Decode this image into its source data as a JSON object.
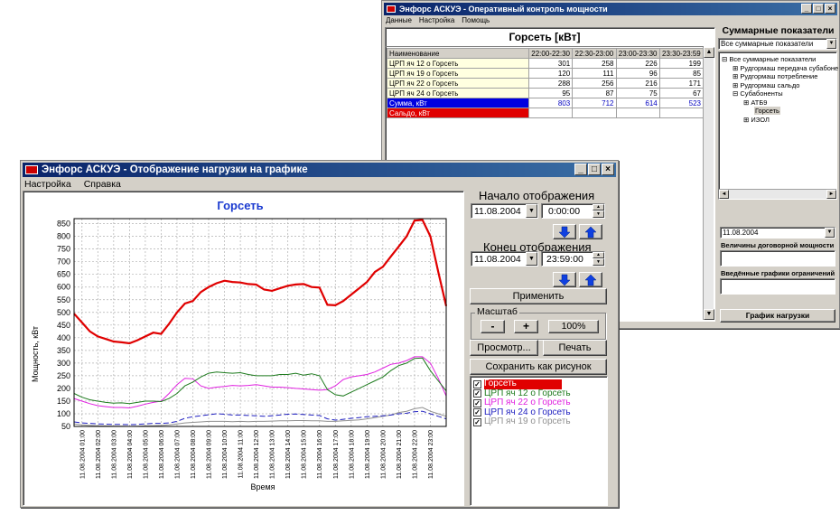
{
  "back_window": {
    "title": "Энфорс АСКУЭ - Оперативный контроль мощности",
    "menu": [
      "Данные",
      "Настройка",
      "Помощь"
    ],
    "table_title": "Горсеть [кВт]",
    "columns": [
      "Наименование",
      "22:00-22:30",
      "22:30-23:00",
      "23:00-23:30",
      "23:30-23:59"
    ],
    "rows": [
      {
        "name": "ЦРП яч 12 о Горсеть",
        "values": [
          "301",
          "258",
          "226",
          "199"
        ],
        "style": "normal"
      },
      {
        "name": "ЦРП яч 19 о Горсеть",
        "values": [
          "120",
          "111",
          "96",
          "85"
        ],
        "style": "normal"
      },
      {
        "name": "ЦРП яч 22 о Горсеть",
        "values": [
          "288",
          "256",
          "216",
          "171"
        ],
        "style": "normal"
      },
      {
        "name": "ЦРП яч 24 о Горсеть",
        "values": [
          "95",
          "87",
          "75",
          "67"
        ],
        "style": "normal"
      },
      {
        "name": "Сумма, кВт",
        "values": [
          "803",
          "712",
          "614",
          "523"
        ],
        "style": "sum"
      },
      {
        "name": "Сальдо, кВт",
        "values": [
          "",
          "",
          "",
          ""
        ],
        "style": "saldo"
      }
    ],
    "side_title": "Суммарные показатели",
    "side_select": "Все суммарные показатели",
    "tree": [
      {
        "sym": "⊟",
        "label": "Все суммарные показатели",
        "level": 0
      },
      {
        "sym": "⊞",
        "label": "Рудгормаш передача субабоне",
        "level": 1
      },
      {
        "sym": "⊞",
        "label": "Рудгормаш потребление",
        "level": 1
      },
      {
        "sym": "⊞",
        "label": "Рудгормаш сальдо",
        "level": 1
      },
      {
        "sym": "⊟",
        "label": "Субабоненты",
        "level": 1
      },
      {
        "sym": "⊞",
        "label": "АТБ9",
        "level": 2
      },
      {
        "sym": "",
        "label": "Горсеть",
        "level": 2
      },
      {
        "sym": "⊞",
        "label": "ИЗОЛ",
        "level": 2
      }
    ],
    "date_value": "11.08.2004",
    "contract_label": "Величины договорной мощности",
    "limits_label": "Введённые графики ограничений",
    "graph_button": "График нагрузки"
  },
  "front_window": {
    "title": "Энфорс АСКУЭ - Отображение нагрузки на графике",
    "menu": [
      "Настройка",
      "Справка"
    ],
    "start_label": "Начало отображения",
    "start_date": "11.08.2004",
    "start_time": "0:00:00",
    "end_label": "Конец отображения",
    "end_date": "11.08.2004",
    "end_time": "23:59:00",
    "apply_button": "Применить",
    "scale_label": "Масштаб",
    "scale_minus": "-",
    "scale_plus": "+",
    "scale_value": "100%",
    "preview_button": "Просмотр...",
    "print_button": "Печать",
    "save_button": "Сохранить как рисунок",
    "legend": [
      {
        "label": "Горсеть",
        "color": "#ffffff",
        "bg": "#e00000"
      },
      {
        "label": "ЦРП яч 12 о Горсеть",
        "color": "#1e7b1e",
        "bg": ""
      },
      {
        "label": "ЦРП яч 22 о Горсеть",
        "color": "#e020e0",
        "bg": ""
      },
      {
        "label": "ЦРП яч 24 о Горсеть",
        "color": "#2020c0",
        "bg": ""
      },
      {
        "label": "ЦРП яч 19 о Горсеть",
        "color": "#909090",
        "bg": ""
      }
    ]
  },
  "chart_data": {
    "type": "line",
    "title": "Горсеть",
    "xlabel": "Время",
    "ylabel": "Мощность, кВт",
    "ylim": [
      50,
      870
    ],
    "yticks": [
      50,
      100,
      150,
      200,
      250,
      300,
      350,
      400,
      450,
      500,
      550,
      600,
      650,
      700,
      750,
      800,
      850
    ],
    "xlim": [
      0.5,
      24.0
    ],
    "x_tick_labels": [
      "11.08.2004 01:00",
      "11.08.2004 02:00",
      "11.08.2004 03:00",
      "11.08.2004 04:00",
      "11.08.2004 05:00",
      "11.08.2004 06:00",
      "11.08.2004 07:00",
      "11.08.2004 08:00",
      "11.08.2004 09:00",
      "11.08.2004 10:00",
      "11.08.2004 11:00",
      "11.08.2004 12:00",
      "11.08.2004 13:00",
      "11.08.2004 14:00",
      "11.08.2004 15:00",
      "11.08.2004 16:00",
      "11.08.2004 17:00",
      "11.08.2004 18:00",
      "11.08.2004 19:00",
      "11.08.2004 20:00",
      "11.08.2004 21:00",
      "11.08.2004 22:00",
      "11.08.2004 23:00"
    ],
    "x_tick_hours": [
      1,
      2,
      3,
      4,
      5,
      6,
      7,
      8,
      9,
      10,
      11,
      12,
      13,
      14,
      15,
      16,
      17,
      18,
      19,
      20,
      21,
      22,
      23
    ],
    "grid": true,
    "series": [
      {
        "name": "Горсеть",
        "color": "#e00000",
        "width": 2.2,
        "dash": "",
        "x": [
          0.5,
          1,
          1.5,
          2,
          2.5,
          3,
          3.5,
          4,
          4.5,
          5,
          5.5,
          6,
          6.5,
          7,
          7.5,
          8,
          8.5,
          9,
          9.5,
          10,
          10.5,
          11,
          11.5,
          12,
          12.5,
          13,
          13.5,
          14,
          14.5,
          15,
          15.5,
          16,
          16.5,
          17,
          17.5,
          18,
          18.5,
          19,
          19.5,
          20,
          20.5,
          21,
          21.5,
          22,
          22.5,
          23,
          23.5,
          24
        ],
        "y": [
          495,
          460,
          425,
          405,
          395,
          385,
          382,
          378,
          390,
          405,
          420,
          415,
          455,
          500,
          535,
          545,
          580,
          600,
          615,
          625,
          620,
          618,
          612,
          610,
          590,
          585,
          595,
          605,
          610,
          612,
          600,
          598,
          530,
          528,
          545,
          570,
          595,
          620,
          660,
          680,
          720,
          760,
          800,
          862,
          865,
          800,
          660,
          525
        ]
      },
      {
        "name": "ЦРП яч 12 о Горсеть",
        "color": "#1e7b1e",
        "width": 1,
        "dash": "",
        "x": [
          0.5,
          1,
          1.5,
          2,
          2.5,
          3,
          3.5,
          4,
          4.5,
          5,
          5.5,
          6,
          6.5,
          7,
          7.5,
          8,
          8.5,
          9,
          9.5,
          10,
          10.5,
          11,
          11.5,
          12,
          12.5,
          13,
          13.5,
          14,
          14.5,
          15,
          15.5,
          16,
          16.5,
          17,
          17.5,
          18,
          18.5,
          19,
          19.5,
          20,
          20.5,
          21,
          21.5,
          22,
          22.5,
          23,
          23.5,
          24
        ],
        "y": [
          180,
          165,
          155,
          150,
          145,
          142,
          143,
          140,
          145,
          150,
          150,
          148,
          160,
          180,
          210,
          225,
          245,
          260,
          265,
          262,
          260,
          262,
          255,
          250,
          250,
          250,
          255,
          255,
          260,
          252,
          258,
          250,
          195,
          175,
          170,
          185,
          200,
          215,
          230,
          245,
          270,
          290,
          300,
          318,
          320,
          270,
          230,
          190
        ]
      },
      {
        "name": "ЦРП яч 22 о Горсеть",
        "color": "#e020e0",
        "width": 1,
        "dash": "",
        "x": [
          0.5,
          1,
          1.5,
          2,
          2.5,
          3,
          3.5,
          4,
          4.5,
          5,
          5.5,
          6,
          6.5,
          7,
          7.5,
          8,
          8.5,
          9,
          9.5,
          10,
          10.5,
          11,
          11.5,
          12,
          12.5,
          13,
          13.5,
          14,
          14.5,
          15,
          15.5,
          16,
          16.5,
          17,
          17.5,
          18,
          18.5,
          19,
          19.5,
          20,
          20.5,
          21,
          21.5,
          22,
          22.5,
          23,
          23.5,
          24
        ],
        "y": [
          160,
          150,
          140,
          132,
          128,
          125,
          125,
          123,
          130,
          138,
          145,
          150,
          180,
          215,
          240,
          238,
          210,
          200,
          205,
          208,
          212,
          210,
          212,
          215,
          210,
          205,
          205,
          203,
          200,
          198,
          195,
          193,
          195,
          210,
          235,
          245,
          250,
          255,
          265,
          280,
          295,
          300,
          310,
          325,
          325,
          300,
          240,
          170
        ]
      },
      {
        "name": "ЦРП яч 24 о Горсеть",
        "color": "#2020c0",
        "width": 1,
        "dash": "6,3",
        "x": [
          0.5,
          1,
          1.5,
          2,
          2.5,
          3,
          3.5,
          4,
          4.5,
          5,
          5.5,
          6,
          6.5,
          7,
          7.5,
          8,
          8.5,
          9,
          9.5,
          10,
          10.5,
          11,
          11.5,
          12,
          12.5,
          13,
          13.5,
          14,
          14.5,
          15,
          15.5,
          16,
          16.5,
          17,
          17.5,
          18,
          18.5,
          19,
          19.5,
          20,
          20.5,
          21,
          21.5,
          22,
          22.5,
          23,
          23.5,
          24
        ],
        "y": [
          68,
          64,
          62,
          60,
          59,
          58,
          58,
          57,
          58,
          60,
          62,
          62,
          64,
          70,
          82,
          88,
          92,
          96,
          100,
          98,
          95,
          95,
          93,
          92,
          90,
          92,
          95,
          98,
          99,
          97,
          95,
          93,
          80,
          75,
          78,
          82,
          85,
          88,
          90,
          92,
          95,
          100,
          102,
          108,
          110,
          100,
          90,
          80
        ]
      },
      {
        "name": "ЦРП яч 19 о Горсеть",
        "color": "#909090",
        "width": 1,
        "dash": "",
        "x": [
          0.5,
          1,
          1.5,
          2,
          2.5,
          3,
          3.5,
          4,
          4.5,
          5,
          5.5,
          6,
          6.5,
          7,
          7.5,
          8,
          8.5,
          9,
          9.5,
          10,
          10.5,
          11,
          11.5,
          12,
          12.5,
          13,
          13.5,
          14,
          14.5,
          15,
          15.5,
          16,
          16.5,
          17,
          17.5,
          18,
          18.5,
          19,
          19.5,
          20,
          20.5,
          21,
          21.5,
          22,
          22.5,
          23,
          23.5,
          24
        ],
        "y": [
          60,
          56,
          54,
          52,
          52,
          51,
          51,
          50,
          51,
          52,
          53,
          54,
          56,
          60,
          64,
          66,
          68,
          70,
          70,
          70,
          69,
          70,
          69,
          70,
          70,
          71,
          72,
          72,
          73,
          73,
          72,
          72,
          70,
          70,
          72,
          74,
          76,
          80,
          85,
          90,
          95,
          105,
          110,
          120,
          125,
          110,
          100,
          90
        ]
      }
    ]
  }
}
